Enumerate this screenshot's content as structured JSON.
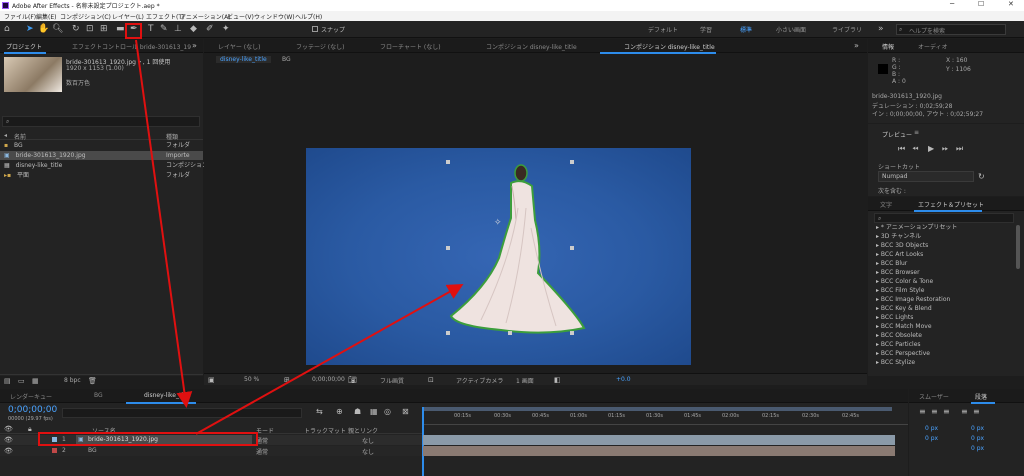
{
  "window": {
    "title": "Adobe After Effects - 名称未設定プロジェクト.aep *",
    "controls": [
      "─",
      "☐",
      "✕"
    ]
  },
  "menu": [
    "ファイル(F)",
    "編集(E)",
    "コンポジション(C)",
    "レイヤー(L)",
    "エフェクト(T)",
    "アニメーション(A)",
    "ビュー(V)",
    "ウィンドウ(W)",
    "ヘルプ(H)"
  ],
  "toolbar": {
    "snap_label": "スナップ",
    "workspaces": [
      "デフォルト",
      "学習",
      "標準",
      "小さい画面",
      "ライブラリ"
    ],
    "search_placeholder": "ヘルプを検索"
  },
  "project": {
    "tabs": [
      "プロジェクト",
      "エフェクトコントロール bride-301613_19"
    ],
    "thumb_name": "bride-301613_1920.jpg ▾ , 1 回使用",
    "thumb_size": "1920 x 1153 (1.00)",
    "thumb_color": "数百万色",
    "search_placeholder": "",
    "col_name": "名前",
    "col_type": "種類",
    "items": [
      {
        "icon": "folder",
        "name": "BG",
        "type": "フォルダ"
      },
      {
        "icon": "image",
        "name": "bride-301613_1920.jpg",
        "type": "Importe"
      },
      {
        "icon": "comp",
        "name": "disney-like_title",
        "type": "コンポジション"
      },
      {
        "icon": "folder",
        "name": "平面",
        "type": "フォルダ"
      }
    ],
    "bit_depth": "8 bpc"
  },
  "viewer": {
    "tabs": [
      "レイヤー (なし)",
      "フッテージ (なし)",
      "フローチャート (なし)",
      "コンポジション disney-like_title",
      "コンポジション disney-like_title"
    ],
    "sub_tabs": [
      "disney-like_title",
      "BG"
    ],
    "zoom": "50 %",
    "timecode": "0;00;00;00",
    "resolution": "フル画質",
    "camera": "アクティブカメラ",
    "views": "1 画面",
    "exposure": "+0.0",
    "bg_color": "#2a5aa3"
  },
  "info": {
    "tabs": [
      "情報",
      "オーディオ"
    ],
    "r": "R :",
    "g": "G :",
    "b": "B :",
    "a": "A : 0",
    "x": "X : 160",
    "y": "Y : 1106",
    "file": "bride-301613_1920.jpg",
    "duration": "デュレーション : 0;02;59;28",
    "inout": "イン : 0;00;00;00, アウト : 0;02;59;27"
  },
  "preview": {
    "title": "プレビュー",
    "shortcut_label": "ショートカット",
    "shortcut_value": "Numpad",
    "include_label": "次を含む :"
  },
  "effects": {
    "tabs": [
      "文字",
      "エフェクト＆プリセット"
    ],
    "search_placeholder": "",
    "items": [
      "▸ * アニメーションプリセット",
      "▸ 3D チャンネル",
      "▸ BCC 3D Objects",
      "▸ BCC Art Looks",
      "▸ BCC Blur",
      "▸ BCC Browser",
      "▸ BCC Color & Tone",
      "▸ BCC Film Style",
      "▸ BCC Image Restoration",
      "▸ BCC Key & Blend",
      "▸ BCC Lights",
      "▸ BCC Match Move",
      "▸ BCC Obsolete",
      "▸ BCC Particles",
      "▸ BCC Perspective",
      "▸ BCC Stylize"
    ]
  },
  "timeline": {
    "tabs": [
      "レンダーキュー",
      "BG",
      "disney-like_title"
    ],
    "timecode": "0;00;00;00",
    "fps": "00000 (29.97 fps)",
    "ruler": [
      "00:15s",
      "00:30s",
      "00:45s",
      "01:00s",
      "01:15s",
      "01:30s",
      "01:45s",
      "02:00s",
      "02:15s",
      "02:30s",
      "02:45s"
    ],
    "col_source": "ソース名",
    "col_mode": "モード",
    "col_trkmat": "トラックマット",
    "col_parent": "親とリンク",
    "layers": [
      {
        "num": "1",
        "name": "bride-301613_1920.jpg",
        "mode": "通常",
        "parent": "なし"
      },
      {
        "num": "2",
        "name": "BG",
        "mode": "通常",
        "parent": "なし"
      }
    ]
  },
  "smoother": {
    "tabs": [
      "スムーザー",
      "段落"
    ],
    "values": [
      "0 px",
      "0 px",
      "0 px",
      "0 px",
      "0 px"
    ]
  },
  "colors": {
    "accent": "#2d8ceb",
    "annotation": "#e01010"
  }
}
